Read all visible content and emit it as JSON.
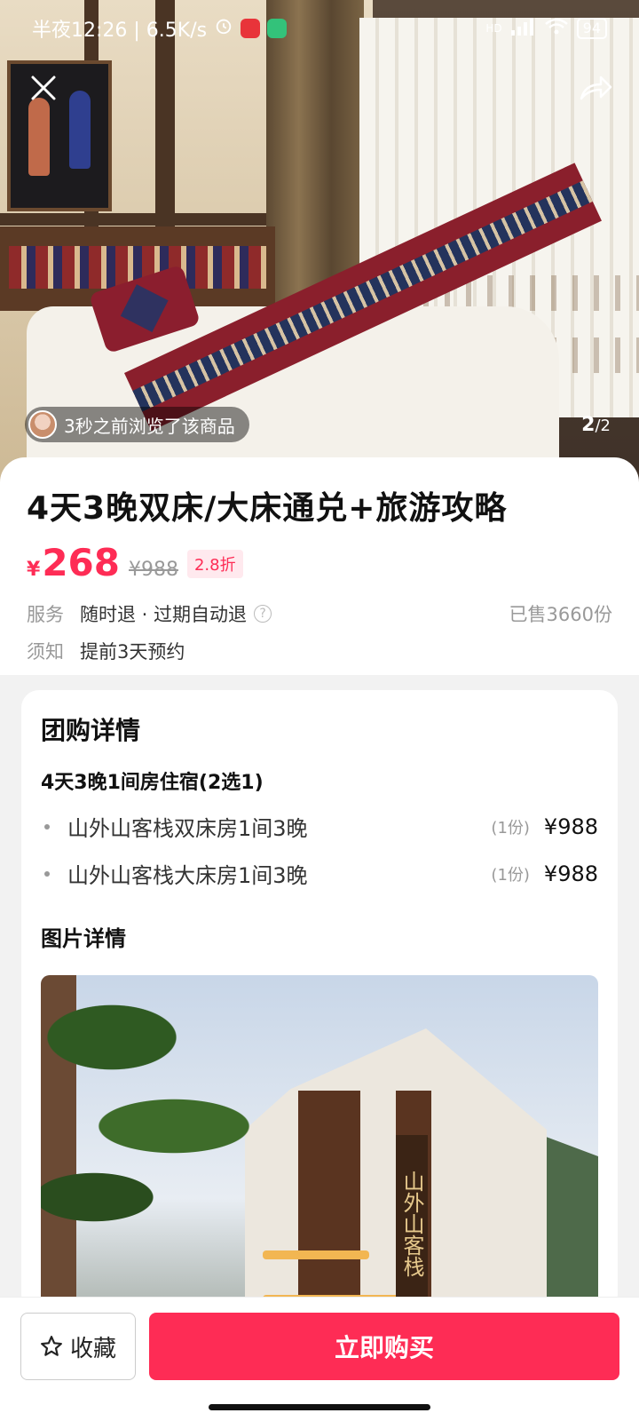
{
  "status_bar": {
    "time_text": "半夜12:26 | 6.5K/s",
    "alarm_icon": "alarm-icon",
    "network_label": "HD",
    "battery": "94"
  },
  "hero": {
    "viewed_text": "3秒之前浏览了该商品",
    "page_current": "2",
    "page_total": "/2"
  },
  "product": {
    "title": "4天3晚双床/大床通兑+旅游攻略",
    "currency": "¥",
    "price": "268",
    "original_price": "¥988",
    "discount": "2.8折",
    "service_label": "服务",
    "service_value": "随时退 · 过期自动退",
    "sold": "已售3660份",
    "notice_label": "须知",
    "notice_value": "提前3天预约"
  },
  "detail": {
    "section_title": "团购详情",
    "package_title": "4天3晚1间房住宿(2选1)",
    "items": [
      {
        "name": "山外山客栈双床房1间3晚",
        "qty": "(1份)",
        "price": "¥988"
      },
      {
        "name": "山外山客栈大床房1间3晚",
        "qty": "(1份)",
        "price": "¥988"
      }
    ],
    "image_section_title": "图片详情",
    "sign_text": "山外山客栈"
  },
  "bottom": {
    "favorite_label": "收藏",
    "buy_label": "立即购买"
  },
  "colors": {
    "accent": "#fe2c55",
    "discount_bg": "#ffe9ee"
  }
}
